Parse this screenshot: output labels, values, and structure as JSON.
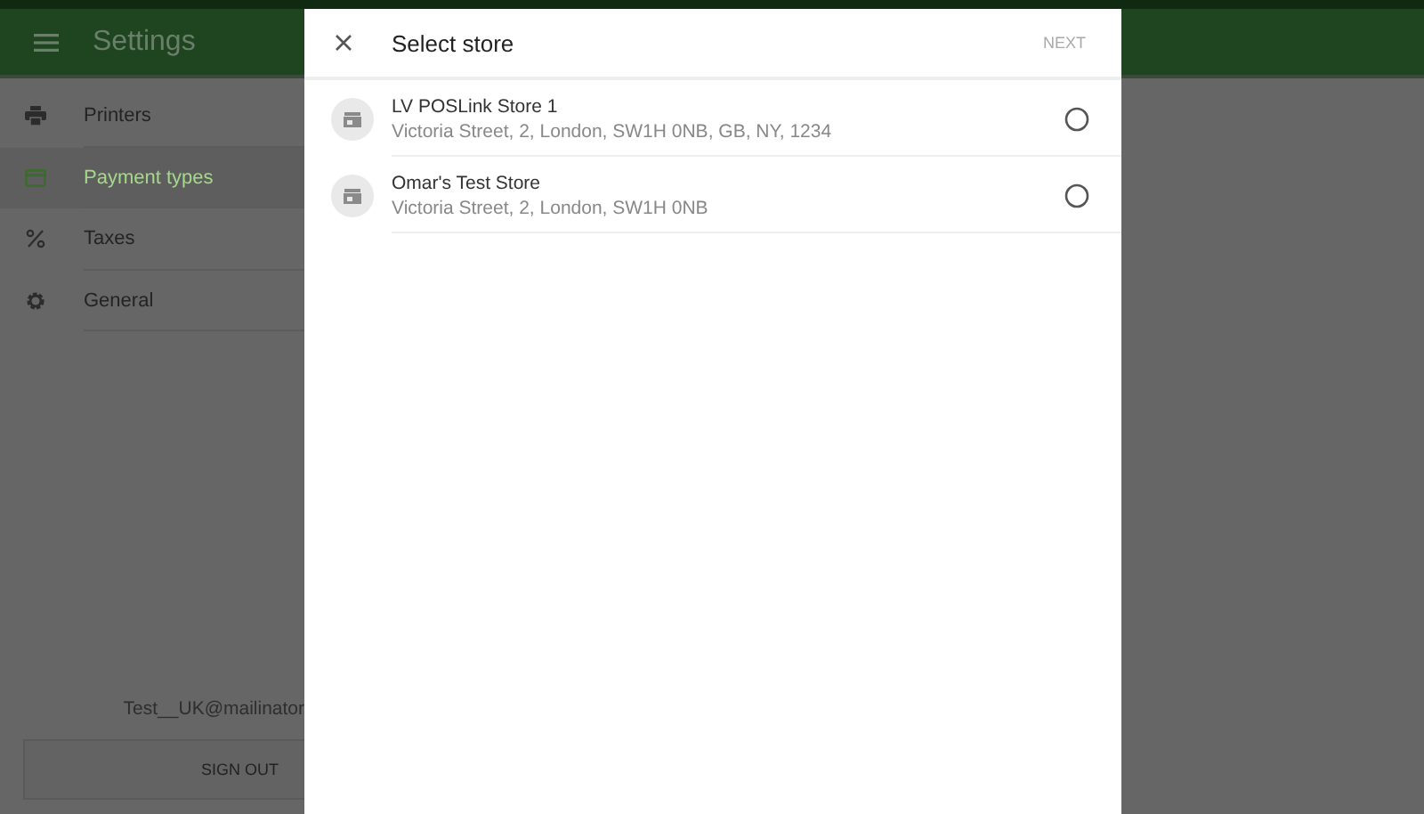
{
  "app_bar": {
    "title": "Settings"
  },
  "sidebar": {
    "items": [
      {
        "label": "Printers",
        "selected": false
      },
      {
        "label": "Payment types",
        "selected": true
      },
      {
        "label": "Taxes",
        "selected": false
      },
      {
        "label": "General",
        "selected": false
      }
    ],
    "account_email": "Test__UK@mailinator",
    "sign_out": "SIGN OUT"
  },
  "dialog": {
    "title": "Select store",
    "next": "NEXT",
    "stores": [
      {
        "name": "LV POSLink Store 1",
        "address": "Victoria Street, 2, London, SW1H 0NB, GB, NY, 1234",
        "selected": false
      },
      {
        "name": "Omar's Test Store",
        "address": "Victoria Street, 2, London, SW1H 0NB",
        "selected": false
      }
    ]
  }
}
